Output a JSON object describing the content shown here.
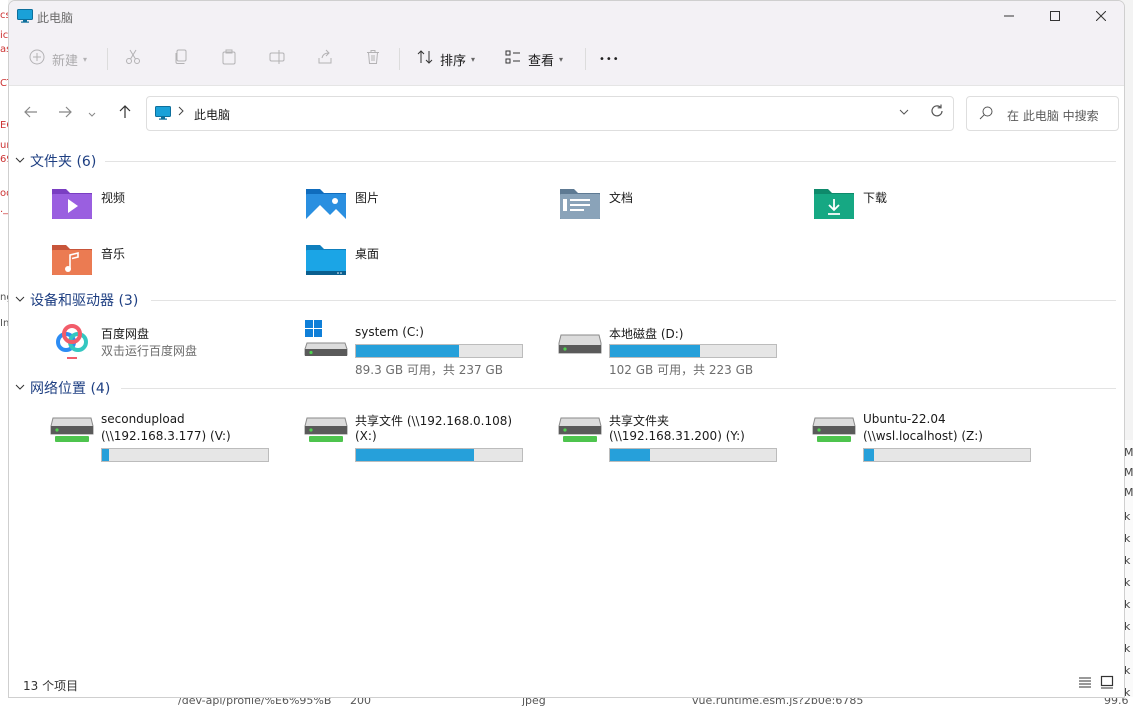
{
  "window": {
    "title": "此电脑",
    "min_glyph": "—",
    "max_glyph": "☐",
    "close_glyph": "✕"
  },
  "toolbar": {
    "new_label": "新建",
    "sort_label": "排序",
    "view_label": "查看",
    "more_label": "•••"
  },
  "nav": {
    "path": "此电脑",
    "search_placeholder": "在 此电脑 中搜索"
  },
  "groups": {
    "folders": {
      "title": "文件夹 (6)"
    },
    "devices": {
      "title": "设备和驱动器 (3)"
    },
    "network": {
      "title": "网络位置 (4)"
    }
  },
  "folders": [
    {
      "name": "视频",
      "icon": "videos-folder-icon"
    },
    {
      "name": "图片",
      "icon": "pictures-folder-icon"
    },
    {
      "name": "文档",
      "icon": "documents-folder-icon"
    },
    {
      "name": "下载",
      "icon": "downloads-folder-icon"
    },
    {
      "name": "音乐",
      "icon": "music-folder-icon"
    },
    {
      "name": "桌面",
      "icon": "desktop-folder-icon"
    }
  ],
  "devices": [
    {
      "name": "百度网盘",
      "sub": "双击运行百度网盘",
      "icon": "baidu-netdisk-icon"
    },
    {
      "name": "system (C:)",
      "free_text": "89.3 GB 可用，共 237 GB",
      "used_fraction": 0.62,
      "icon": "windows-drive-icon"
    },
    {
      "name": "本地磁盘 (D:)",
      "free_text": "102 GB 可用，共 223 GB",
      "used_fraction": 0.54,
      "icon": "drive-icon"
    }
  ],
  "network": [
    {
      "name": "secondupload",
      "sub": "(\\\\192.168.3.177) (V:)",
      "used_fraction": 0.04,
      "icon": "network-drive-icon"
    },
    {
      "name": "共享文件 (\\\\192.168.0.108)",
      "sub": "(X:)",
      "used_fraction": 0.71,
      "icon": "network-drive-icon"
    },
    {
      "name": "共享文件夹",
      "sub": "(\\\\192.168.31.200) (Y:)",
      "used_fraction": 0.24,
      "icon": "network-drive-icon"
    },
    {
      "name": "Ubuntu-22.04",
      "sub": "(\\\\wsl.localhost) (Z:)",
      "used_fraction": 0.06,
      "icon": "network-drive-icon"
    }
  ],
  "status": {
    "count": "13 个项目"
  },
  "background": {
    "bottom_texts": [
      "/dev-api/profile/%E6%95%B",
      "200",
      "jpeg",
      "vue.runtime.esm.js?2b0e:6785",
      "99.6"
    ],
    "left_frags": [
      "cs",
      "ic",
      "as",
      "CT",
      "EC",
      "un",
      "69",
      "od",
      "._",
      "ng",
      "In"
    ],
    "right_frags": [
      "M",
      "M",
      "M",
      "k",
      "k",
      "k",
      "k",
      "k",
      "k",
      "k",
      "k",
      "k"
    ]
  },
  "colors": {
    "accent": "#1e3f82",
    "bar_fill": "#26a0da",
    "bar_track": "#e6e6e6"
  }
}
